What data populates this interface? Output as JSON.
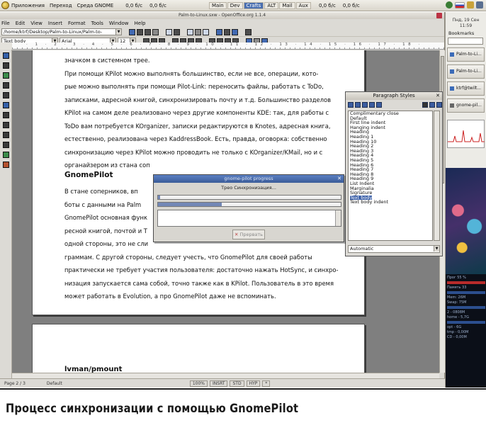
{
  "gnome_panel": {
    "menu": [
      "Приложения",
      "Переход",
      "Среда GNOME"
    ],
    "net_down": "0,0 б/с",
    "net_up": "0,0 б/с",
    "workspaces": [
      "Main",
      "Dev",
      "Crafts",
      "ALT",
      "Mail",
      "Aux"
    ],
    "active_workspace": "Crafts",
    "net2_down": "0,0 б/с",
    "net2_up": "0,0 б/с"
  },
  "window": {
    "title": "Palm-to-Linux.sxw - OpenOffice.org 1.1.4"
  },
  "menubar": [
    "File",
    "Edit",
    "View",
    "Insert",
    "Format",
    "Tools",
    "Window",
    "Help"
  ],
  "toolbar": {
    "path": "/home/ktrf/Desktop/Palm-to-Linux/Palm-to-",
    "paragraph_style": "Text body",
    "font_name": "Arial",
    "font_size": "12"
  },
  "ruler": {
    "numbers": "· 1 · 2 · 3 · 4 · 5 · 6 · 7 · 8 · 9 · 10 · 11 · 12 · 13 · 14 · 15 · 16 · 17 · 18 ·"
  },
  "document": {
    "lines_p1": [
      "значком в системном трее.",
      "      При помощи KPilot можно выполнять большинство, если не все, операции, кото-",
      "рые можно выполнять при помощи Pilot-Link: переносить файлы, работать с ToDo,",
      "записками, адресной книгой, синхронизировать почту и т.д. Большинство разделов",
      "KPilot на самом деле реализовано через другие компоненты KDE: так, для работы с",
      "ToDo вам потребуется KOrganizer, записки редактируются в Knotes, адресная книга,",
      "естественно, реализована через KaddressBook. Есть, правда, оговорка: собственно",
      "синхронизацию через KPilot можно проводить не только с KOrganizer/KMail, но и с",
      "органайзером из стана соп"
    ],
    "heading_gnome": "GnomePilot",
    "lines_p2": [
      "      В стане соперников, вп",
      "боты с данными на Palm",
      "GnomePilot основная функ",
      "ресной книгой, почтой и Т",
      "одной стороны, это не сли",
      "граммам. С другой стороны, следует учесть, что GnomePilot для своей работы",
      "практически не требует участия пользователя: достаточно нажать HotSync, и синхро-",
      "низация запускается сама собой, точно также как в KPilot. Пользователь в это время",
      "может работать в Evolution, а про GnomePilot даже не вспоминать."
    ],
    "heading_lvman": "lvman/pmount"
  },
  "statusbar": {
    "page": "Page 2 / 3",
    "style": "Default",
    "cells": [
      "100%",
      "INSRT",
      "STD",
      "HYP",
      "*"
    ]
  },
  "styles_window": {
    "title": "Paragraph Styles",
    "items": [
      "Complimentary close",
      "Default",
      "First line indent",
      "Hanging indent",
      "Heading",
      "Heading 1",
      "Heading 10",
      "Heading 2",
      "Heading 3",
      "Heading 4",
      "Heading 5",
      "Heading 6",
      "Heading 7",
      "Heading 8",
      "Heading 9",
      "List Indent",
      "Marginalia",
      "Signature",
      "Text body",
      "Text body indent"
    ],
    "selected": "Text body",
    "filter": "Automatic"
  },
  "sync_dialog": {
    "title": "gnome-pilot progress",
    "status": "Треo Синхронизация...",
    "progress1": 0.01,
    "progress2": 0.35,
    "cancel_label": "Прервать"
  },
  "right_panel": {
    "clock_date": "Пнд, 19 Сен",
    "clock_time": "11:59",
    "bookmarks_label": "Bookmarks",
    "tasks": [
      "Palm-to-Li...",
      "Palm-to-Li...",
      "ktrf@twilt...",
      "gnome-pil..."
    ],
    "sysmon": [
      "Прог    55 %",
      "Память  33",
      "Mem: 26M",
      "Swap: 75M",
      "2 - 0808M",
      "home - 5,7G",
      "opt - 6G",
      "tmp - 0,00M",
      "CD - 0,00M"
    ]
  },
  "caption": "Процесс синхронизации с помощью GnomePilot"
}
